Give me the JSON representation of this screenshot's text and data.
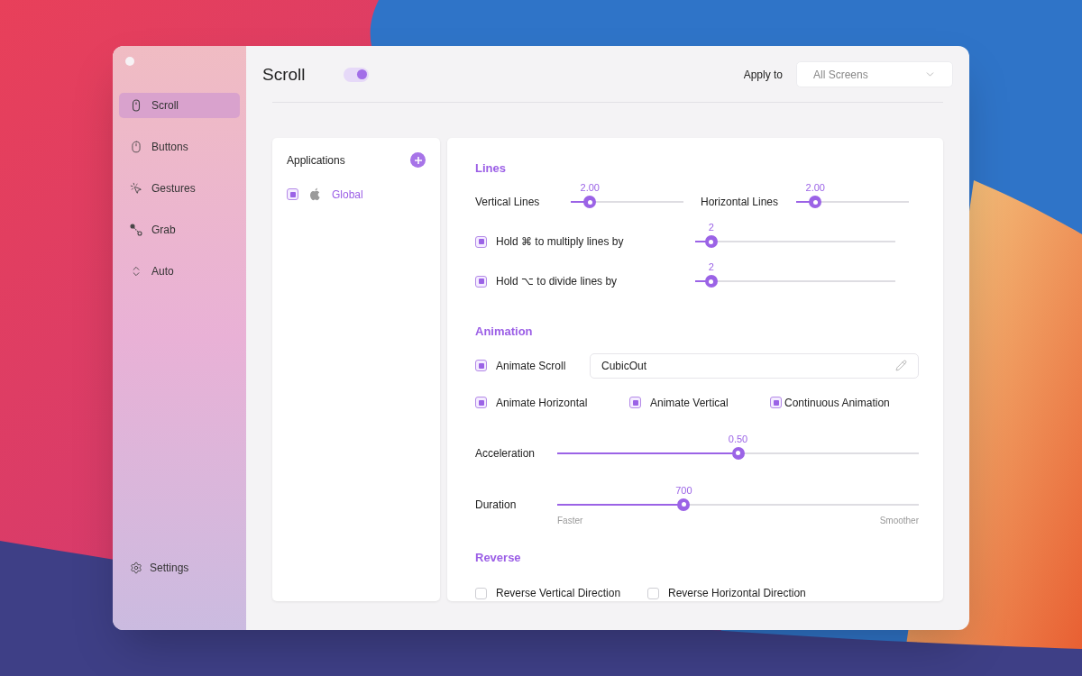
{
  "sidebar": {
    "items": [
      {
        "label": "Scroll",
        "selected": true
      },
      {
        "label": "Buttons",
        "selected": false
      },
      {
        "label": "Gestures",
        "selected": false
      },
      {
        "label": "Grab",
        "selected": false
      },
      {
        "label": "Auto",
        "selected": false
      }
    ],
    "footer": {
      "label": "Settings"
    }
  },
  "header": {
    "title": "Scroll",
    "enabled": true,
    "apply_label": "Apply to",
    "apply_value": "All Screens"
  },
  "applications": {
    "title": "Applications",
    "items": [
      {
        "label": "Global",
        "checked": true,
        "selected": true
      }
    ]
  },
  "lines": {
    "title": "Lines",
    "sliders": [
      {
        "label": "Vertical Lines",
        "reading": "2.00",
        "level": 0.17
      },
      {
        "label": "Horizontal Lines",
        "reading": "2.00",
        "level": 0.17
      }
    ],
    "modifiers": [
      {
        "label": "Hold ⌘ to multiply lines by",
        "checked": true,
        "reading": "2",
        "level": 0.08
      },
      {
        "label": "Hold ⌥ to divide lines by",
        "checked": true,
        "reading": "2",
        "level": 0.08
      }
    ]
  },
  "animation": {
    "title": "Animation",
    "animate_scroll": {
      "label": "Animate Scroll",
      "checked": true,
      "curve": "CubicOut"
    },
    "options": [
      {
        "label": "Animate Horizontal",
        "checked": true
      },
      {
        "label": "Animate Vertical",
        "checked": true
      },
      {
        "label": "Continuous Animation",
        "checked": true
      }
    ],
    "acceleration": {
      "label": "Acceleration",
      "reading": "0.50",
      "level": 0.5
    },
    "duration": {
      "label": "Duration",
      "reading": "700",
      "level": 0.35,
      "min_label": "Faster",
      "max_label": "Smoother"
    }
  },
  "reverse": {
    "title": "Reverse",
    "options": [
      {
        "label": "Reverse Vertical Direction",
        "checked": false
      },
      {
        "label": "Reverse Horizontal Direction",
        "checked": false
      }
    ]
  }
}
